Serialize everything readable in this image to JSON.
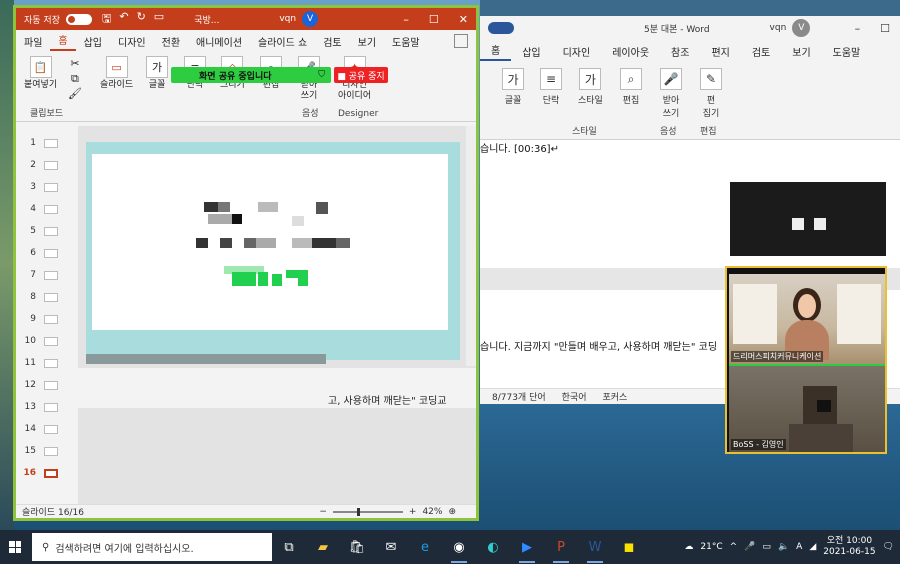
{
  "ppt": {
    "autosave": "자동 저장",
    "filename": "국방...",
    "user": "vqn",
    "avatar": "V",
    "tabs": [
      "파일",
      "홈",
      "삽입",
      "디자인",
      "전환",
      "애니메이션",
      "슬라이드 쇼",
      "검토",
      "보기",
      "도움말"
    ],
    "ribbon": {
      "paste": "붙여넣기",
      "slides": "슬라이드",
      "font": "글꼴",
      "paragraph": "단락",
      "drawing": "그리기",
      "editing": "편집",
      "dictate": "받아\n쓰기",
      "designer": "디자인\n아이디어",
      "clipboard_label": "클립보드",
      "voice_label": "음성",
      "designer_label": "Designer"
    },
    "share_bar": "화면 공유 중입니다",
    "stop_share": "■ 공유 중지",
    "thumbs": [
      "1",
      "2",
      "3",
      "4",
      "5",
      "6",
      "7",
      "8",
      "9",
      "10",
      "11",
      "12",
      "13",
      "14",
      "15",
      "16"
    ],
    "notes_text": "고, 사용하며 깨닫는\" 코딩교",
    "status_slide": "슬라이드 16/16",
    "zoom": "42%"
  },
  "word": {
    "title": "5분 대본 - Word",
    "user": "vqn",
    "avatar": "V",
    "tabs": [
      "홈",
      "삽입",
      "디자인",
      "레이아웃",
      "참조",
      "편지",
      "검토",
      "보기",
      "도움말"
    ],
    "ribbon": {
      "font": "글꼴",
      "paragraph": "단락",
      "style": "스타일",
      "editing": "편집",
      "dictate": "받아\n쓰기",
      "editor": "편\n집기",
      "style_label": "스타일",
      "voice_label": "음성",
      "edit_label": "편집"
    },
    "line1": "습니다. [00:36]↵",
    "line2": "습니다. 지금까지 \"만들며 배우고, 사용하며 깨닫는\" 코딩",
    "status": [
      "8/773개 단어",
      "한국어",
      "포커스"
    ]
  },
  "zoom_participants": [
    {
      "name": "드리머스피치커뮤니케이션"
    },
    {
      "name": "BoSS - 김영인"
    }
  ],
  "taskbar": {
    "search_placeholder": "검색하려면 여기에 입력하십시오.",
    "weather": "21°C",
    "ime": "A",
    "time": "오전 10:00",
    "date": "2021-06-15"
  }
}
